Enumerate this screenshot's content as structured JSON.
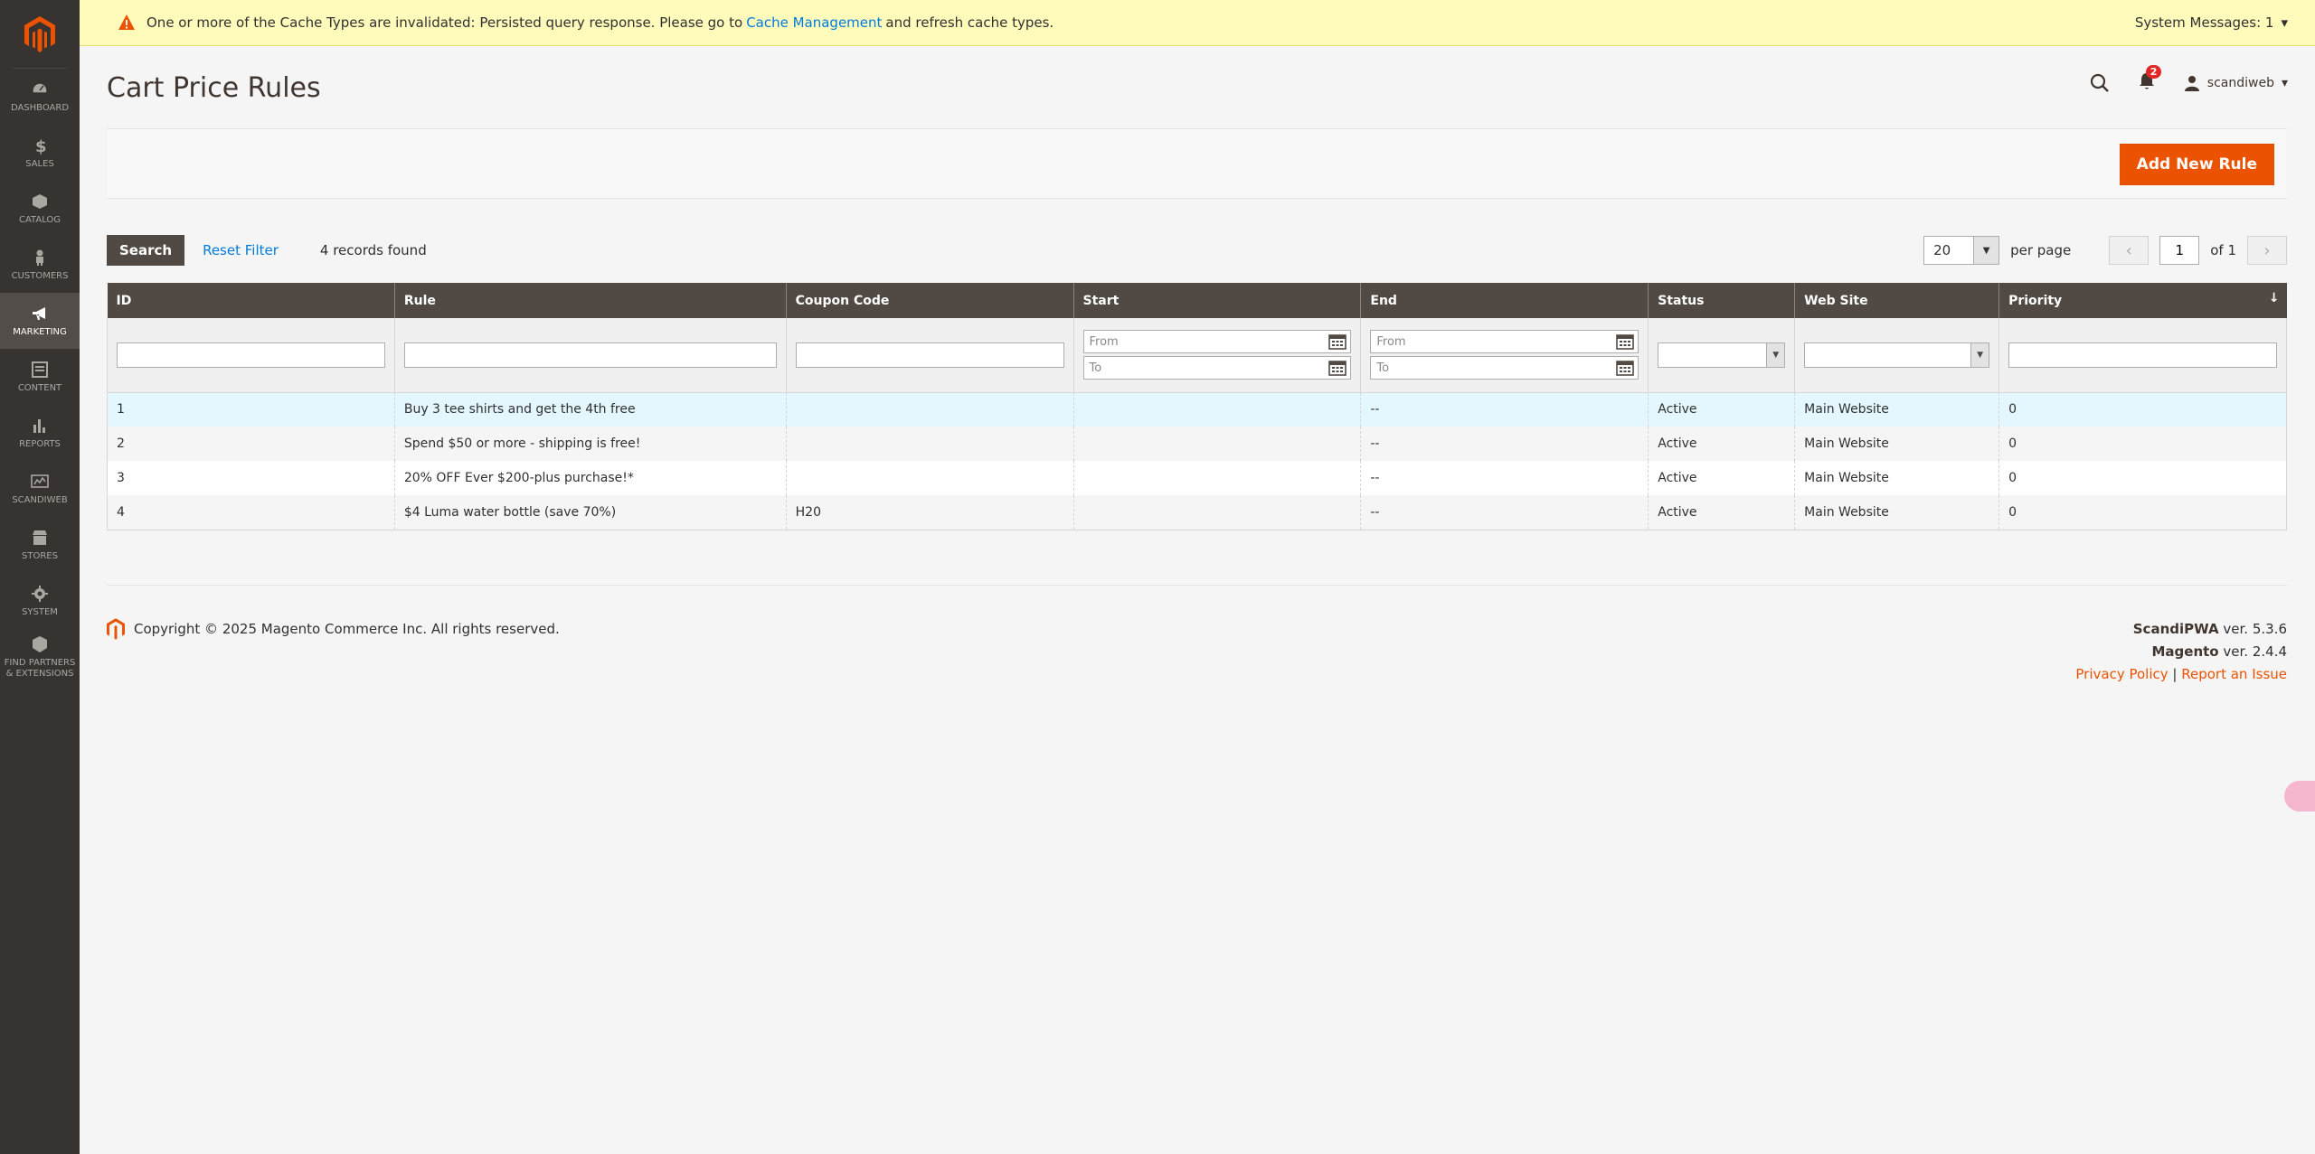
{
  "sidebar": {
    "items": [
      {
        "label": "DASHBOARD",
        "icon": "dashboard-icon"
      },
      {
        "label": "SALES",
        "icon": "dollar-icon"
      },
      {
        "label": "CATALOG",
        "icon": "box-icon"
      },
      {
        "label": "CUSTOMERS",
        "icon": "person-icon"
      },
      {
        "label": "MARKETING",
        "icon": "megaphone-icon",
        "active": true
      },
      {
        "label": "CONTENT",
        "icon": "layout-icon"
      },
      {
        "label": "REPORTS",
        "icon": "bar-chart-icon"
      },
      {
        "label": "SCANDIWEB",
        "icon": "scandiweb-icon"
      },
      {
        "label": "STORES",
        "icon": "store-icon"
      },
      {
        "label": "SYSTEM",
        "icon": "gear-icon"
      },
      {
        "label": "FIND PARTNERS & EXTENSIONS",
        "icon": "cube-icon"
      }
    ]
  },
  "system_message": {
    "text_before": "One or more of the Cache Types are invalidated: Persisted query response. Please go to",
    "link": "Cache Management",
    "text_after": "and refresh cache types.",
    "counter": "System Messages: 1"
  },
  "header": {
    "title": "Cart Price Rules",
    "notifications_count": "2",
    "user": "scandiweb"
  },
  "actions": {
    "add_new_rule": "Add New Rule"
  },
  "toolbar": {
    "search": "Search",
    "reset_filter": "Reset Filter",
    "records": "4 records found",
    "per_page_value": "20",
    "per_page_label": "per page",
    "page": "1",
    "of_pages": "of 1"
  },
  "grid": {
    "columns": {
      "id": "ID",
      "rule": "Rule",
      "coupon": "Coupon Code",
      "start": "Start",
      "end": "End",
      "status": "Status",
      "website": "Web Site",
      "priority": "Priority"
    },
    "filter_placeholders": {
      "from": "From",
      "to": "To"
    },
    "rows": [
      {
        "id": "1",
        "rule": "Buy 3 tee shirts and get the 4th free",
        "coupon": "",
        "start": "",
        "end": "--",
        "status": "Active",
        "website": "Main Website",
        "priority": "0"
      },
      {
        "id": "2",
        "rule": "Spend $50 or more - shipping is free!",
        "coupon": "",
        "start": "",
        "end": "--",
        "status": "Active",
        "website": "Main Website",
        "priority": "0"
      },
      {
        "id": "3",
        "rule": "20% OFF Ever $200-plus purchase!*",
        "coupon": "",
        "start": "",
        "end": "--",
        "status": "Active",
        "website": "Main Website",
        "priority": "0"
      },
      {
        "id": "4",
        "rule": "$4 Luma water bottle (save 70%)",
        "coupon": "H20",
        "start": "",
        "end": "--",
        "status": "Active",
        "website": "Main Website",
        "priority": "0"
      }
    ]
  },
  "footer": {
    "copyright": "Copyright © 2025 Magento Commerce Inc. All rights reserved.",
    "scandipwa_name": "ScandiPWA",
    "scandipwa_ver": "ver. 5.3.6",
    "magento_name": "Magento",
    "magento_ver": "ver. 2.4.4",
    "privacy": "Privacy Policy",
    "separator": "|",
    "report": "Report an Issue"
  },
  "colors": {
    "brand": "#eb5202",
    "sidebar": "#373330",
    "link": "#007bdb"
  }
}
